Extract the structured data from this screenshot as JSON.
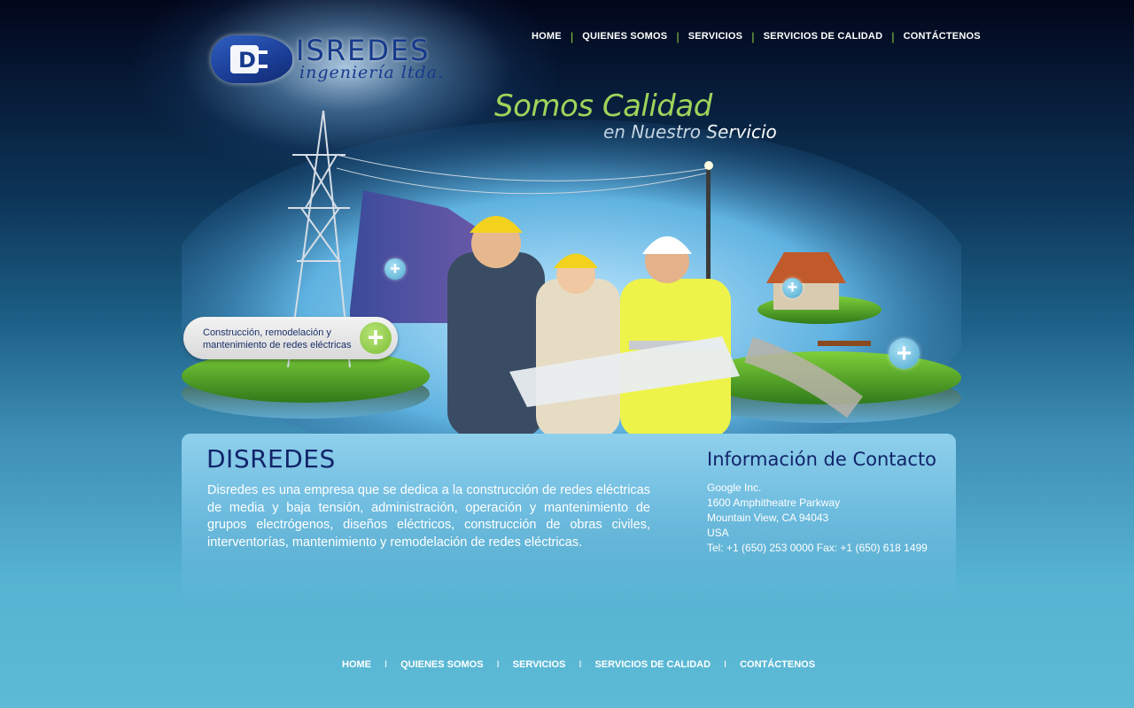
{
  "logo": {
    "name": "ISREDES",
    "subtitle": "ingeniería ltda.",
    "mark_letter": "D"
  },
  "top_nav": {
    "items": [
      "HOME",
      "QUIENES SOMOS",
      "SERVICIOS",
      "SERVICIOS DE CALIDAD",
      "CONTÁCTENOS"
    ],
    "separator": "|"
  },
  "hero": {
    "slogan_main": "Somos Calidad",
    "slogan_sub": "en Nuestro Servicio",
    "callout_text": "Construcción, remodelación y mantenimiento de redes eléctricas",
    "plus_symbol": "+"
  },
  "about": {
    "title": "DISREDES",
    "text": "Disredes es una empresa que se dedica a la construcción de redes eléctricas de media y baja tensión, administración, operación y mantenimiento de grupos electrógenos, diseños eléctricos, construcción de obras civiles, interventorías, mantenimiento y remodelación de redes eléctricas."
  },
  "contact": {
    "title": "Información de Contacto",
    "company": "Google Inc.",
    "street": "1600 Amphitheatre Parkway",
    "city": "Mountain View, CA 94043",
    "country": "USA",
    "phones": "Tel: +1 (650) 253 0000 Fax: +1 (650) 618 1499"
  },
  "footer_nav": {
    "items": [
      "HOME",
      "QUIENES SOMOS",
      "SERVICIOS",
      "SERVICIOS DE CALIDAD",
      "CONTÁCTENOS"
    ],
    "separator": "I"
  },
  "colors": {
    "accent_green": "#9fd45a",
    "title_navy": "#12246a",
    "bg_top": "#02061a",
    "bg_bottom": "#5cbad6"
  },
  "icons": {
    "logo_mark": "plug-shield-icon",
    "hero_plus": "plus-icon"
  }
}
